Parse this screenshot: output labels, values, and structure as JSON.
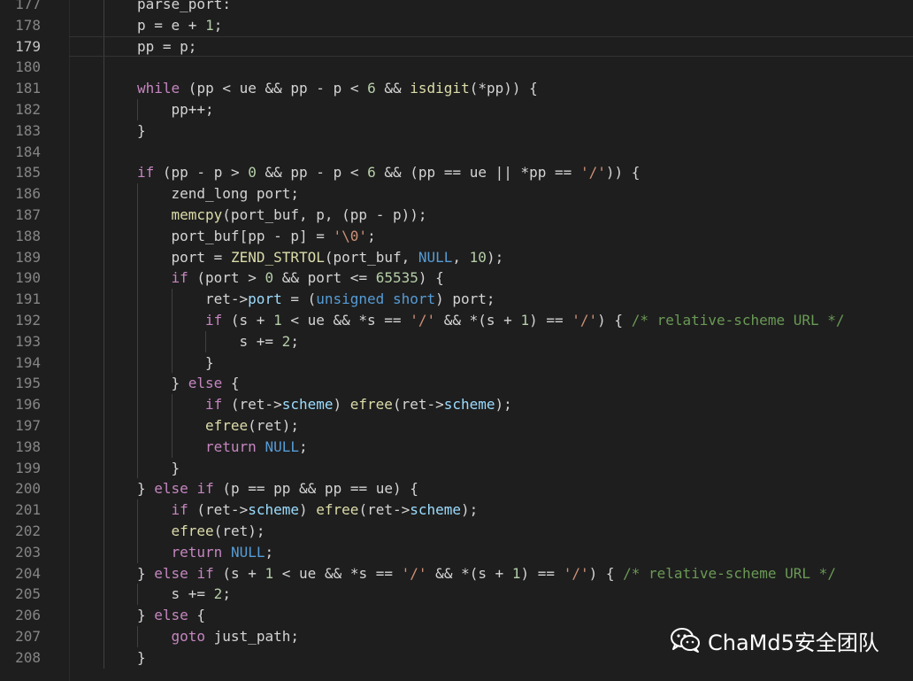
{
  "editor": {
    "current_line": 179,
    "lines": [
      {
        "num": "177",
        "indent": 0,
        "tokens": [
          {
            "t": "tx",
            "v": "parse_port:"
          }
        ]
      },
      {
        "num": "178",
        "indent": 0,
        "tokens": [
          {
            "t": "tx",
            "v": "p = e + "
          },
          {
            "t": "nm",
            "v": "1"
          },
          {
            "t": "tx",
            "v": ";"
          }
        ]
      },
      {
        "num": "179",
        "indent": 0,
        "tokens": [
          {
            "t": "tx",
            "v": "pp = p;"
          }
        ]
      },
      {
        "num": "180",
        "indent": 0,
        "tokens": []
      },
      {
        "num": "181",
        "indent": 0,
        "tokens": [
          {
            "t": "kw",
            "v": "while"
          },
          {
            "t": "tx",
            "v": " (pp < ue && pp - p < "
          },
          {
            "t": "nm",
            "v": "6"
          },
          {
            "t": "tx",
            "v": " && "
          },
          {
            "t": "fn",
            "v": "isdigit"
          },
          {
            "t": "tx",
            "v": "(*pp)) {"
          }
        ]
      },
      {
        "num": "182",
        "indent": 1,
        "tokens": [
          {
            "t": "tx",
            "v": "pp++;"
          }
        ]
      },
      {
        "num": "183",
        "indent": 0,
        "tokens": [
          {
            "t": "tx",
            "v": "}"
          }
        ]
      },
      {
        "num": "184",
        "indent": 0,
        "tokens": []
      },
      {
        "num": "185",
        "indent": 0,
        "tokens": [
          {
            "t": "kw",
            "v": "if"
          },
          {
            "t": "tx",
            "v": " (pp - p > "
          },
          {
            "t": "nm",
            "v": "0"
          },
          {
            "t": "tx",
            "v": " && pp - p < "
          },
          {
            "t": "nm",
            "v": "6"
          },
          {
            "t": "tx",
            "v": " && (pp == ue || *pp == "
          },
          {
            "t": "st",
            "v": "'/'"
          },
          {
            "t": "tx",
            "v": ")) {"
          }
        ]
      },
      {
        "num": "186",
        "indent": 1,
        "tokens": [
          {
            "t": "tx",
            "v": "zend_long port;"
          }
        ]
      },
      {
        "num": "187",
        "indent": 1,
        "tokens": [
          {
            "t": "fn",
            "v": "memcpy"
          },
          {
            "t": "tx",
            "v": "(port_buf, p, (pp - p));"
          }
        ]
      },
      {
        "num": "188",
        "indent": 1,
        "tokens": [
          {
            "t": "tx",
            "v": "port_buf[pp - p] = "
          },
          {
            "t": "st",
            "v": "'\\0'"
          },
          {
            "t": "tx",
            "v": ";"
          }
        ]
      },
      {
        "num": "189",
        "indent": 1,
        "tokens": [
          {
            "t": "tx",
            "v": "port = "
          },
          {
            "t": "fn",
            "v": "ZEND_STRTOL"
          },
          {
            "t": "tx",
            "v": "(port_buf, "
          },
          {
            "t": "kb",
            "v": "NULL"
          },
          {
            "t": "tx",
            "v": ", "
          },
          {
            "t": "nm",
            "v": "10"
          },
          {
            "t": "tx",
            "v": ");"
          }
        ]
      },
      {
        "num": "190",
        "indent": 1,
        "tokens": [
          {
            "t": "kw",
            "v": "if"
          },
          {
            "t": "tx",
            "v": " (port > "
          },
          {
            "t": "nm",
            "v": "0"
          },
          {
            "t": "tx",
            "v": " && port <= "
          },
          {
            "t": "nm",
            "v": "65535"
          },
          {
            "t": "tx",
            "v": ") {"
          }
        ]
      },
      {
        "num": "191",
        "indent": 2,
        "tokens": [
          {
            "t": "tx",
            "v": "ret->"
          },
          {
            "t": "mb",
            "v": "port"
          },
          {
            "t": "tx",
            "v": " = ("
          },
          {
            "t": "kb",
            "v": "unsigned"
          },
          {
            "t": "tx",
            "v": " "
          },
          {
            "t": "kb",
            "v": "short"
          },
          {
            "t": "tx",
            "v": ") port;"
          }
        ]
      },
      {
        "num": "192",
        "indent": 2,
        "tokens": [
          {
            "t": "kw",
            "v": "if"
          },
          {
            "t": "tx",
            "v": " (s + "
          },
          {
            "t": "nm",
            "v": "1"
          },
          {
            "t": "tx",
            "v": " < ue && *s == "
          },
          {
            "t": "st",
            "v": "'/'"
          },
          {
            "t": "tx",
            "v": " && *(s + "
          },
          {
            "t": "nm",
            "v": "1"
          },
          {
            "t": "tx",
            "v": ") == "
          },
          {
            "t": "st",
            "v": "'/'"
          },
          {
            "t": "tx",
            "v": ") { "
          },
          {
            "t": "cm",
            "v": "/* relative-scheme URL */"
          }
        ]
      },
      {
        "num": "193",
        "indent": 3,
        "tokens": [
          {
            "t": "tx",
            "v": "s += "
          },
          {
            "t": "nm",
            "v": "2"
          },
          {
            "t": "tx",
            "v": ";"
          }
        ]
      },
      {
        "num": "194",
        "indent": 2,
        "tokens": [
          {
            "t": "tx",
            "v": "}"
          }
        ]
      },
      {
        "num": "195",
        "indent": 1,
        "tokens": [
          {
            "t": "tx",
            "v": "} "
          },
          {
            "t": "kw",
            "v": "else"
          },
          {
            "t": "tx",
            "v": " {"
          }
        ]
      },
      {
        "num": "196",
        "indent": 2,
        "tokens": [
          {
            "t": "kw",
            "v": "if"
          },
          {
            "t": "tx",
            "v": " (ret->"
          },
          {
            "t": "mb",
            "v": "scheme"
          },
          {
            "t": "tx",
            "v": ") "
          },
          {
            "t": "fn",
            "v": "efree"
          },
          {
            "t": "tx",
            "v": "(ret->"
          },
          {
            "t": "mb",
            "v": "scheme"
          },
          {
            "t": "tx",
            "v": ");"
          }
        ]
      },
      {
        "num": "197",
        "indent": 2,
        "tokens": [
          {
            "t": "fn",
            "v": "efree"
          },
          {
            "t": "tx",
            "v": "(ret);"
          }
        ]
      },
      {
        "num": "198",
        "indent": 2,
        "tokens": [
          {
            "t": "kw",
            "v": "return"
          },
          {
            "t": "tx",
            "v": " "
          },
          {
            "t": "kb",
            "v": "NULL"
          },
          {
            "t": "tx",
            "v": ";"
          }
        ]
      },
      {
        "num": "199",
        "indent": 1,
        "tokens": [
          {
            "t": "tx",
            "v": "}"
          }
        ]
      },
      {
        "num": "200",
        "indent": 0,
        "tokens": [
          {
            "t": "tx",
            "v": "} "
          },
          {
            "t": "kw",
            "v": "else"
          },
          {
            "t": "tx",
            "v": " "
          },
          {
            "t": "kw",
            "v": "if"
          },
          {
            "t": "tx",
            "v": " (p == pp && pp == ue) {"
          }
        ]
      },
      {
        "num": "201",
        "indent": 1,
        "tokens": [
          {
            "t": "kw",
            "v": "if"
          },
          {
            "t": "tx",
            "v": " (ret->"
          },
          {
            "t": "mb",
            "v": "scheme"
          },
          {
            "t": "tx",
            "v": ") "
          },
          {
            "t": "fn",
            "v": "efree"
          },
          {
            "t": "tx",
            "v": "(ret->"
          },
          {
            "t": "mb",
            "v": "scheme"
          },
          {
            "t": "tx",
            "v": ");"
          }
        ]
      },
      {
        "num": "202",
        "indent": 1,
        "tokens": [
          {
            "t": "fn",
            "v": "efree"
          },
          {
            "t": "tx",
            "v": "(ret);"
          }
        ]
      },
      {
        "num": "203",
        "indent": 1,
        "tokens": [
          {
            "t": "kw",
            "v": "return"
          },
          {
            "t": "tx",
            "v": " "
          },
          {
            "t": "kb",
            "v": "NULL"
          },
          {
            "t": "tx",
            "v": ";"
          }
        ]
      },
      {
        "num": "204",
        "indent": 0,
        "tokens": [
          {
            "t": "tx",
            "v": "} "
          },
          {
            "t": "kw",
            "v": "else"
          },
          {
            "t": "tx",
            "v": " "
          },
          {
            "t": "kw",
            "v": "if"
          },
          {
            "t": "tx",
            "v": " (s + "
          },
          {
            "t": "nm",
            "v": "1"
          },
          {
            "t": "tx",
            "v": " < ue && *s == "
          },
          {
            "t": "st",
            "v": "'/'"
          },
          {
            "t": "tx",
            "v": " && *(s + "
          },
          {
            "t": "nm",
            "v": "1"
          },
          {
            "t": "tx",
            "v": ") == "
          },
          {
            "t": "st",
            "v": "'/'"
          },
          {
            "t": "tx",
            "v": ") { "
          },
          {
            "t": "cm",
            "v": "/* relative-scheme URL */"
          }
        ]
      },
      {
        "num": "205",
        "indent": 1,
        "tokens": [
          {
            "t": "tx",
            "v": "s += "
          },
          {
            "t": "nm",
            "v": "2"
          },
          {
            "t": "tx",
            "v": ";"
          }
        ]
      },
      {
        "num": "206",
        "indent": 0,
        "tokens": [
          {
            "t": "tx",
            "v": "} "
          },
          {
            "t": "kw",
            "v": "else"
          },
          {
            "t": "tx",
            "v": " {"
          }
        ]
      },
      {
        "num": "207",
        "indent": 1,
        "tokens": [
          {
            "t": "kw",
            "v": "goto"
          },
          {
            "t": "tx",
            "v": " just_path;"
          }
        ]
      },
      {
        "num": "208",
        "indent": 0,
        "tokens": [
          {
            "t": "tx",
            "v": "}"
          }
        ]
      }
    ]
  },
  "watermark": {
    "icon": "wechat-icon",
    "text": "ChaMd5安全团队"
  },
  "colors": {
    "background": "#1e1e1e",
    "keyword": "#c586c0",
    "builtin": "#569cd6",
    "function": "#dcdcaa",
    "number": "#b5cea8",
    "string": "#ce9178",
    "comment": "#6a9955",
    "member": "#9cdcfe",
    "line_number": "#858585"
  }
}
